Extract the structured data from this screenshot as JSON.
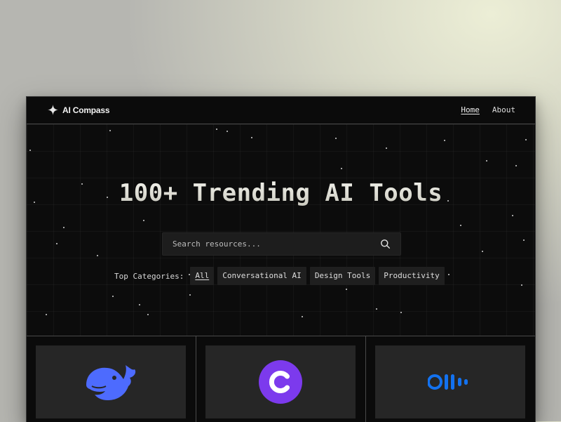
{
  "app": {
    "logo_text": "AI Compass",
    "logo_icon": "sparkle-icon"
  },
  "nav": {
    "items": [
      {
        "label": "Home",
        "active": true
      },
      {
        "label": "About",
        "active": false
      }
    ]
  },
  "hero": {
    "title": "100+ Trending AI Tools",
    "search": {
      "placeholder": "Search resources...",
      "value": "",
      "icon": "search-icon"
    },
    "categories": {
      "label": "Top Categories:",
      "items": [
        {
          "label": "All",
          "active": true
        },
        {
          "label": "Conversational AI",
          "active": false
        },
        {
          "label": "Design Tools",
          "active": false
        },
        {
          "label": "Productivity",
          "active": false
        }
      ]
    }
  },
  "cards": [
    {
      "icon": "whale-logo-icon",
      "color": "#4D6BFE"
    },
    {
      "icon": "letter-c-logo-icon",
      "color": "#7C3AED"
    },
    {
      "icon": "waveform-logo-icon",
      "color": "#1372F0"
    }
  ],
  "colors": {
    "window_bg": "#0b0b0b",
    "chip_bg": "#1f1f1f",
    "card_thumb_bg": "#262626"
  }
}
